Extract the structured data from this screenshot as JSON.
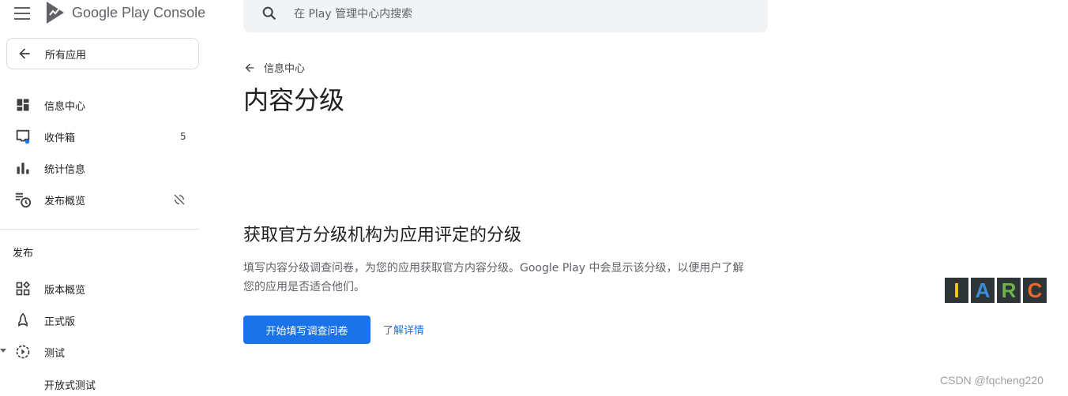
{
  "brand": {
    "name": "Google Play Console"
  },
  "sidebar": {
    "all_apps_label": "所有应用",
    "items": [
      {
        "label": "信息中心",
        "icon": "dashboard-icon"
      },
      {
        "label": "收件箱",
        "icon": "inbox-icon",
        "badge": "5"
      },
      {
        "label": "统计信息",
        "icon": "bar-chart-icon"
      },
      {
        "label": "发布概览",
        "icon": "publishing-overview-icon",
        "trailing_icon": "sync-off-icon"
      }
    ],
    "section_title": "发布",
    "release_items": [
      {
        "label": "版本概览",
        "icon": "releases-overview-icon"
      },
      {
        "label": "正式版",
        "icon": "production-icon"
      },
      {
        "label": "测试",
        "icon": "testing-icon"
      }
    ],
    "sub_items": [
      {
        "label": "开放式测试"
      }
    ]
  },
  "search": {
    "placeholder": "在 Play 管理中心内搜索"
  },
  "breadcrumb": {
    "label": "信息中心"
  },
  "page": {
    "title": "内容分级",
    "card_title": "获取官方分级机构为应用评定的分级",
    "description": "填写内容分级调查问卷，为您的应用获取官方内容分级。Google Play 中会显示该分级，以便用户了解您的应用是否适合他们。",
    "primary_button": "开始填写调查问卷",
    "learn_more": "了解详情"
  },
  "iarc": {
    "letters": [
      {
        "char": "I",
        "color": "#f5d000"
      },
      {
        "char": "A",
        "color": "#3d8ed8"
      },
      {
        "char": "R",
        "color": "#6bb34a"
      },
      {
        "char": "C",
        "color": "#e8682a"
      }
    ]
  },
  "watermark": "CSDN @fqcheng220",
  "colors": {
    "accent": "#1a73e8",
    "badge_dot": "#1a73e8"
  }
}
